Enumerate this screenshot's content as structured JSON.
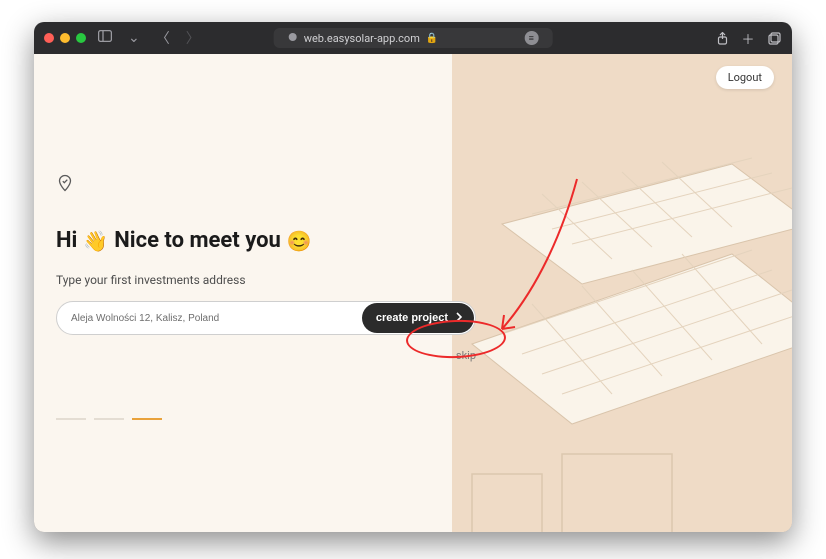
{
  "browser": {
    "url": "web.easysolar-app.com",
    "lock": "🔒"
  },
  "header": {
    "logout": "Logout"
  },
  "onboarding": {
    "greeting_pre": "Hi",
    "wave_emoji": "👋",
    "greeting_post": "Nice to meet you",
    "smile_emoji": "😊",
    "subtitle": "Type your first investments address",
    "address_value": "Aleja Wolności 12, Kalisz, Poland",
    "create_label": "create project",
    "skip_label": "skip"
  },
  "progress": {
    "total": 3,
    "active_index": 2
  }
}
